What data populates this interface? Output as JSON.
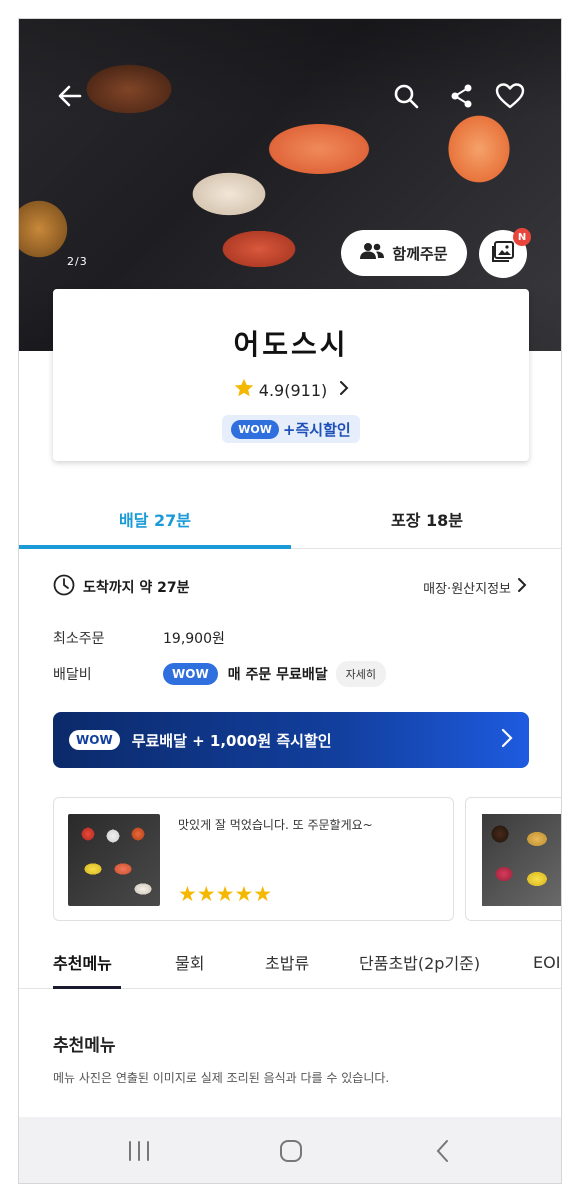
{
  "hero": {
    "page_indicator": "2/3",
    "group_order_label": "함께주문",
    "photo_badge": "N"
  },
  "store": {
    "name": "어도스시",
    "rating": "4.9(911)",
    "wow_label": "WOW",
    "promo": "+즉시할인"
  },
  "delivery_tabs": [
    {
      "label": "배달 27분",
      "active": true
    },
    {
      "label": "포장 18분",
      "active": false
    }
  ],
  "info": {
    "arrival": "도착까지 약 27분",
    "store_info_link": "매장·원산지정보",
    "min_order_label": "최소주문",
    "min_order_value": "19,900원",
    "delivery_fee_label": "배달비",
    "wow_label": "WOW",
    "delivery_fee_text": "매 주문 무료배달",
    "detail_label": "자세히"
  },
  "wow_banner": {
    "wow_label": "WOW",
    "text": "무료배달 + 1,000원 즉시할인"
  },
  "reviews": [
    {
      "text": "맛있게 잘 먹었습니다. 또 주문할게요~",
      "stars": 5,
      "star_glyphs": "★★★★★"
    }
  ],
  "menu_tabs": [
    {
      "label": "추천메뉴",
      "active": true
    },
    {
      "label": "물회",
      "active": false
    },
    {
      "label": "초밥류",
      "active": false
    },
    {
      "label": "단품초밥(2p기준)",
      "active": false
    },
    {
      "label": "EOI",
      "active": false
    }
  ],
  "section": {
    "title": "추천메뉴",
    "description": "메뉴 사진은 연출된 이미지로 실제 조리된 음식과 다를 수 있습니다."
  },
  "colors": {
    "accent": "#1a9ad6",
    "wow_blue": "#2f6fde",
    "banner_dark": "#0b2a6a",
    "star": "#f5b800",
    "badge_red": "#e8463c"
  },
  "icons": [
    "back-arrow-icon",
    "search-icon",
    "share-icon",
    "heart-icon",
    "group-icon",
    "photo-icon",
    "star-icon",
    "chevron-right-icon",
    "clock-icon",
    "recent-apps-icon",
    "home-icon",
    "nav-back-icon"
  ]
}
